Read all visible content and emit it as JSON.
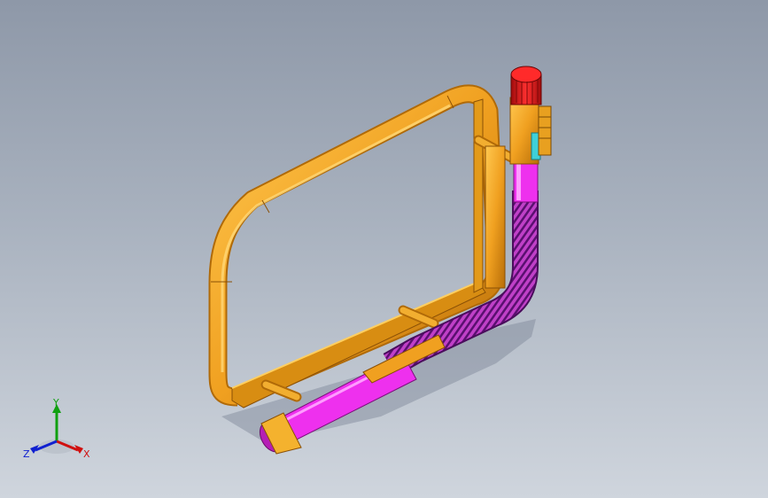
{
  "viewport": {
    "colors": {
      "background_top": "#8e98a8",
      "background_bottom": "#cfd5dd",
      "frame": "#f0a020",
      "frame_shadow": "#b06a08",
      "flex_hose": "#9a2aa6",
      "sleeve": "#ee30ee",
      "cap": "#d81818",
      "connector": "#3fd0d8"
    }
  },
  "model": {
    "parts": [
      "frame-tube",
      "flexible-hose",
      "hose-sleeve",
      "end-cap",
      "terminal-block",
      "support-pins"
    ]
  },
  "triad": {
    "x_label": "X",
    "y_label": "Y",
    "z_label": "Z",
    "colors": {
      "x": "#d01010",
      "y": "#10a010",
      "z": "#1020d0"
    }
  }
}
